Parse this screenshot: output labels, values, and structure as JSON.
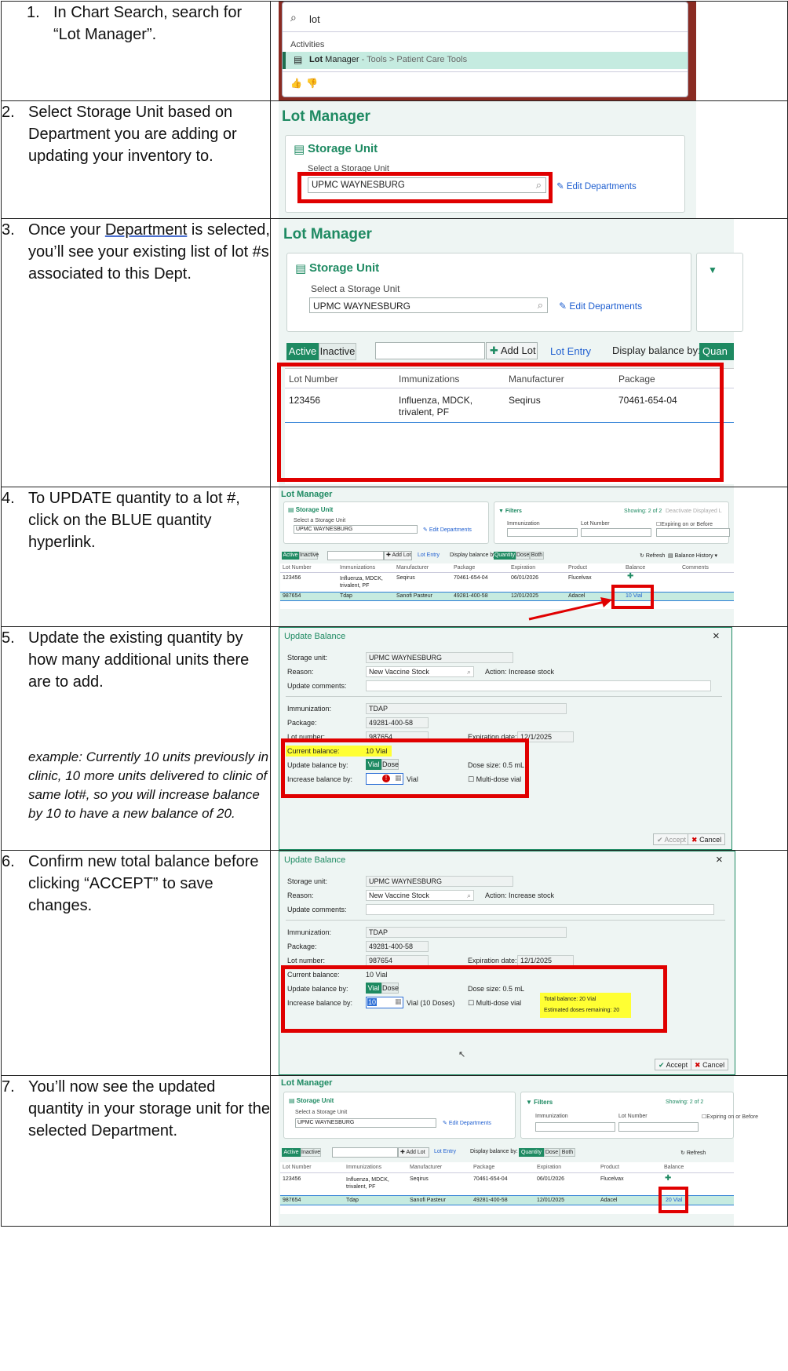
{
  "steps": [
    {
      "num": "1.",
      "text": "In Chart Search, search for “Lot Manager”."
    },
    {
      "num": "2.",
      "text": "Select Storage Unit based on Department you are adding or updating your inventory to."
    },
    {
      "num": "3.",
      "text_pre": "Once your ",
      "text_link": "Department",
      "text_post": " is selected, you’ll see your existing list of lot #s associated to this Dept."
    },
    {
      "num": "4.",
      "text": "To UPDATE quantity to a lot #, click on the BLUE quantity hyperlink."
    },
    {
      "num": "5.",
      "text": "Update the existing quantity by how many additional units there are to add.",
      "example": "example: Currently 10 units previously in clinic, 10 more units delivered to clinic of same lot#, so you will increase balance by 10 to have a new balance of 20."
    },
    {
      "num": "6.",
      "text": "Confirm new total balance before clicking “ACCEPT” to save changes."
    },
    {
      "num": "7.",
      "text": "You’ll now see the updated quantity in your storage unit for the selected Department."
    }
  ],
  "search": {
    "query": "lot",
    "section": "Activities",
    "result_bold": "Lot",
    "result_rest": " Manager",
    "result_path": " - Tools > Patient Care Tools"
  },
  "lotmgr": {
    "title": "Lot Manager",
    "storage_title": "Storage Unit",
    "select_label": "Select a Storage Unit",
    "unit_value": "UPMC WAYNESBURG",
    "edit_departments": "Edit Departments",
    "filters": "Filters",
    "showing": "Showing: 2 of 2",
    "deactivate": "Deactivate Displayed L",
    "immunization_lbl": "Immunization",
    "lotnum_lbl": "Lot Number",
    "expiring": "Expiring on or Before",
    "active": "Active",
    "inactive": "Inactive",
    "add_lot": "Add Lot",
    "lot_entry": "Lot Entry",
    "display_balance": "Display balance by:",
    "quantity": "Quantity",
    "quantity_short": "Quan",
    "dose": "Dose",
    "both": "Both",
    "refresh": "Refresh",
    "balance_history": "Balance History",
    "columns": [
      "Lot Number",
      "Immunizations",
      "Manufacturer",
      "Package",
      "Expiration",
      "Product",
      "Balance",
      "Comments"
    ],
    "rows": [
      {
        "lot": "123456",
        "imm": "Influenza, MDCK, trivalent, PF",
        "imm1": "Influenza, MDCK,",
        "imm2": "trivalent, PF",
        "mfr": "Seqirus",
        "pkg": "70461-654-04",
        "exp": "06/01/2026",
        "prod": "Flucelvax"
      },
      {
        "lot": "987654",
        "imm": "Tdap",
        "mfr": "Sanofi Pasteur",
        "pkg": "49281-400-58",
        "exp": "12/01/2025",
        "prod": "Adacel",
        "bal_before": "10 Vial",
        "bal_after": "20 Vial"
      }
    ]
  },
  "dialog": {
    "title": "Update Balance",
    "close": "×",
    "storage_lbl": "Storage unit:",
    "storage_val": "UPMC WAYNESBURG",
    "reason_lbl": "Reason:",
    "reason_val": "New Vaccine Stock",
    "action": "Action: Increase stock",
    "comments_lbl": "Update comments:",
    "imm_lbl": "Immunization:",
    "imm_val": "TDAP",
    "pkg_lbl": "Package:",
    "pkg_val": "49281-400-58",
    "lot_lbl": "Lot number:",
    "lot_val": "987654",
    "exp_lbl": "Expiration date:",
    "exp_val": "12/1/2025",
    "cur_lbl": "Current balance:",
    "cur_val": "10 Vial",
    "upd_lbl": "Update balance by:",
    "vial": "Vial",
    "dose": "Dose",
    "dose_size": "Dose size: 0.5 mL",
    "inc_lbl": "Increase balance by:",
    "inc_val": "10",
    "vial_unit": "Vial",
    "vial_doses": "Vial (10 Doses)",
    "multidose": "Multi-dose vial",
    "total": "Total balance: 20 Vial",
    "est": "Estimated doses remaining: 20",
    "accept": "Accept",
    "cancel": "Cancel"
  },
  "colors": {
    "accent": "#1e8a62",
    "red": "#e00000",
    "highlight": "#ffff33",
    "link": "#1f5fd0"
  }
}
